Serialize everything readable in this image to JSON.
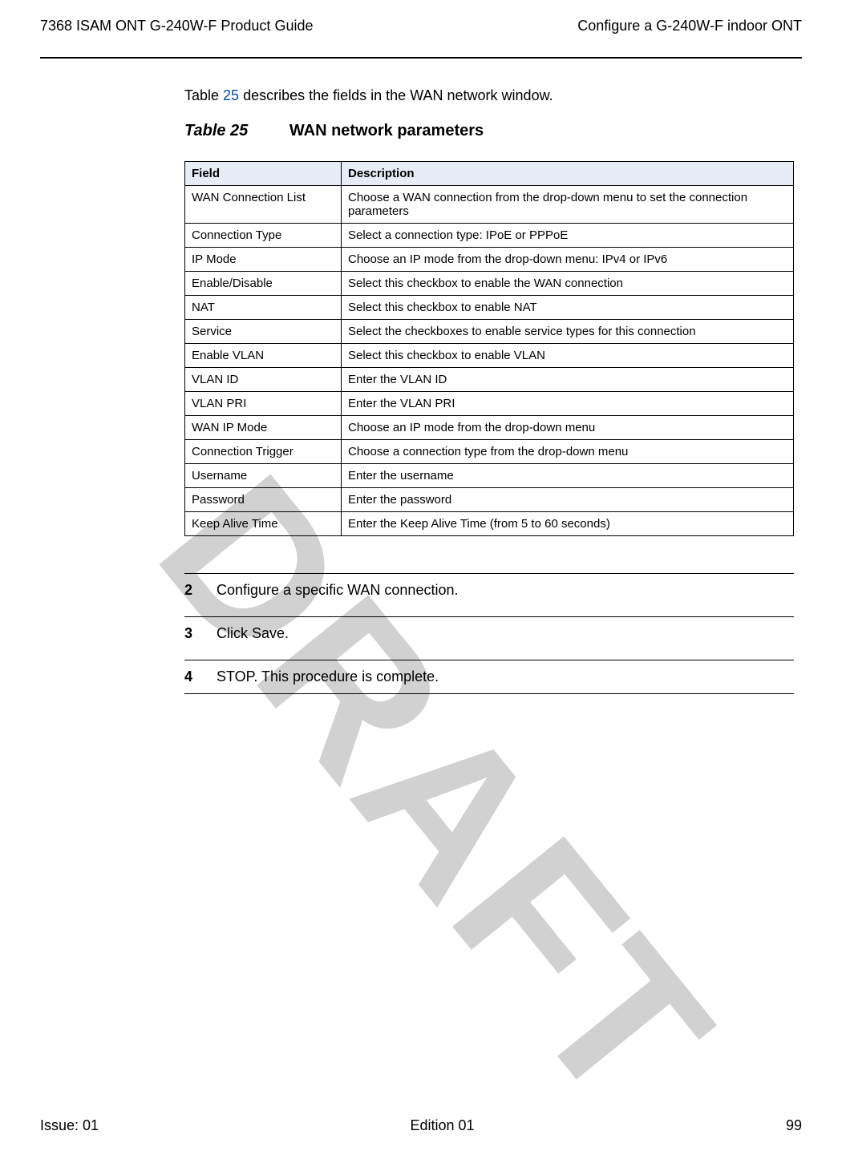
{
  "watermark": "DRAFT",
  "header": {
    "left": "7368 ISAM ONT G-240W-F Product Guide",
    "right": "Configure a G-240W-F indoor ONT"
  },
  "intro": {
    "prefix": "Table ",
    "link": "25",
    "suffix": " describes the fields in the WAN network window."
  },
  "table": {
    "caption_num": "Table 25",
    "caption_title": "WAN network parameters",
    "columns": [
      "Field",
      "Description"
    ],
    "rows": [
      {
        "field": "WAN Connection List",
        "desc": "Choose a WAN connection from the drop-down menu to set the connection parameters"
      },
      {
        "field": "Connection Type",
        "desc": "Select a connection type: IPoE or PPPoE"
      },
      {
        "field": "IP Mode",
        "desc": "Choose an IP mode from the drop-down menu: IPv4 or IPv6"
      },
      {
        "field": "Enable/Disable",
        "desc": "Select this checkbox to enable the WAN connection"
      },
      {
        "field": "NAT",
        "desc": "Select this checkbox to enable NAT"
      },
      {
        "field": "Service",
        "desc": "Select the checkboxes to enable service types for this connection"
      },
      {
        "field": "Enable VLAN",
        "desc": "Select this checkbox to enable VLAN"
      },
      {
        "field": "VLAN ID",
        "desc": "Enter the VLAN ID"
      },
      {
        "field": "VLAN PRI",
        "desc": "Enter the VLAN PRI"
      },
      {
        "field": "WAN IP Mode",
        "desc": "Choose an IP mode from the drop-down menu"
      },
      {
        "field": "Connection Trigger",
        "desc": "Choose a connection type from the drop-down menu"
      },
      {
        "field": "Username",
        "desc": "Enter the username"
      },
      {
        "field": "Password",
        "desc": "Enter the password"
      },
      {
        "field": "Keep Alive Time",
        "desc": "Enter the Keep Alive Time (from 5 to 60 seconds)"
      }
    ]
  },
  "steps": [
    {
      "num": "2",
      "text": "Configure a specific WAN connection."
    },
    {
      "num": "3",
      "text": "Click Save."
    },
    {
      "num": "4",
      "text": "STOP. This procedure is complete."
    }
  ],
  "footer": {
    "left": "Issue: 01",
    "center": "Edition 01",
    "right": "99"
  }
}
